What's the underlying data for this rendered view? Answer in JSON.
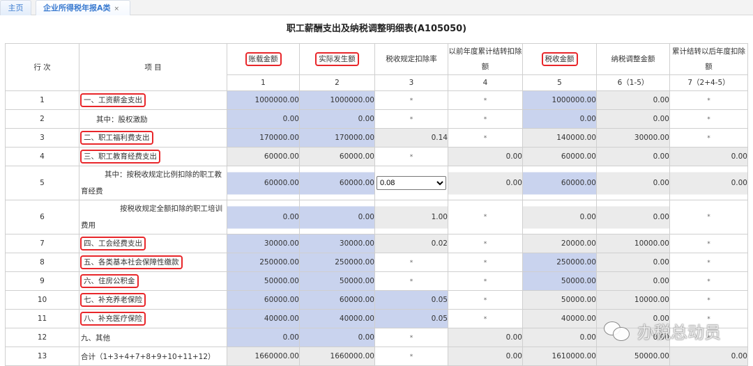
{
  "tabs": {
    "home": "主页",
    "active": "企业所得税年报A类",
    "close": "×"
  },
  "title": "职工薪酬支出及纳税调整明细表(A105050)",
  "headers": {
    "row_no": "行 次",
    "item": "项 目",
    "cols": [
      {
        "label": "账载金额",
        "num": "1",
        "highlighted": true
      },
      {
        "label": "实际发生额",
        "num": "2",
        "highlighted": true
      },
      {
        "label": "税收规定扣除率",
        "num": "3",
        "highlighted": false
      },
      {
        "label": "以前年度累计结转扣除额",
        "num": "4",
        "highlighted": false
      },
      {
        "label": "税收金额",
        "num": "5",
        "highlighted": true
      },
      {
        "label": "纳税调整金额",
        "num": "6（1-5）",
        "highlighted": false
      },
      {
        "label": "累计结转以后年度扣除额",
        "num": "7（2+4-5）",
        "highlighted": false
      }
    ]
  },
  "rows": [
    {
      "no": "1",
      "item": "一、工资薪金支出",
      "highlighted": true,
      "sub": false,
      "cells": [
        "1000000.00",
        "1000000.00",
        "*",
        "*",
        "1000000.00",
        "0.00",
        "*"
      ]
    },
    {
      "no": "2",
      "item": "其中：股权激励",
      "highlighted": false,
      "sub": true,
      "cells": [
        "0.00",
        "0.00",
        "*",
        "*",
        "0.00",
        "0.00",
        "*"
      ]
    },
    {
      "no": "3",
      "item": "二、职工福利费支出",
      "highlighted": true,
      "sub": false,
      "cells": [
        "170000.00",
        "170000.00",
        "0.14",
        "*",
        "140000.00",
        "30000.00",
        "*"
      ]
    },
    {
      "no": "4",
      "item": "三、职工教育经费支出",
      "highlighted": true,
      "sub": false,
      "cells": [
        "60000.00",
        "60000.00",
        "*",
        "0.00",
        "60000.00",
        "0.00",
        "0.00"
      ]
    },
    {
      "no": "5",
      "item": "其中：按税收规定比例扣除的职工教育经费",
      "highlighted": false,
      "sub": true,
      "cells": [
        "60000.00",
        "60000.00",
        "0.08",
        "0.00",
        "60000.00",
        "0.00",
        "0.00"
      ]
    },
    {
      "no": "6",
      "item": "按税收规定全额扣除的职工培训费用",
      "highlighted": false,
      "sub": true,
      "cells": [
        "0.00",
        "0.00",
        "1.00",
        "*",
        "0.00",
        "0.00",
        "*"
      ]
    },
    {
      "no": "7",
      "item": "四、工会经费支出",
      "highlighted": true,
      "sub": false,
      "cells": [
        "30000.00",
        "30000.00",
        "0.02",
        "*",
        "20000.00",
        "10000.00",
        "*"
      ]
    },
    {
      "no": "8",
      "item": "五、各类基本社会保障性缴款",
      "highlighted": true,
      "sub": false,
      "cells": [
        "250000.00",
        "250000.00",
        "*",
        "*",
        "250000.00",
        "0.00",
        "*"
      ]
    },
    {
      "no": "9",
      "item": "六、住房公积金",
      "highlighted": true,
      "sub": false,
      "cells": [
        "50000.00",
        "50000.00",
        "*",
        "*",
        "50000.00",
        "0.00",
        "*"
      ]
    },
    {
      "no": "10",
      "item": "七、补充养老保险",
      "highlighted": true,
      "sub": false,
      "cells": [
        "60000.00",
        "60000.00",
        "0.05",
        "*",
        "50000.00",
        "10000.00",
        "*"
      ]
    },
    {
      "no": "11",
      "item": "八、补充医疗保险",
      "highlighted": true,
      "sub": false,
      "cells": [
        "40000.00",
        "40000.00",
        "0.05",
        "*",
        "40000.00",
        "0.00",
        "*"
      ]
    },
    {
      "no": "12",
      "item": "九、其他",
      "highlighted": false,
      "sub": false,
      "cells": [
        "0.00",
        "0.00",
        "*",
        "0.00",
        "0.00",
        "0.00",
        "*"
      ]
    },
    {
      "no": "13",
      "item": "合计（1+3+4+7+8+9+10+11+12）",
      "highlighted": false,
      "sub": false,
      "cells": [
        "1660000.00",
        "1660000.00",
        "*",
        "0.00",
        "1610000.00",
        "50000.00",
        "0.00"
      ]
    }
  ],
  "rate_select": {
    "value": "0.08",
    "options": [
      "0.08"
    ]
  },
  "watermark": "办税总动员",
  "colors": {
    "editable": "#c9d3ee",
    "computed": "#ebebeb",
    "highlight_border": "#e8262a",
    "tab_text": "#3b7bd0"
  }
}
